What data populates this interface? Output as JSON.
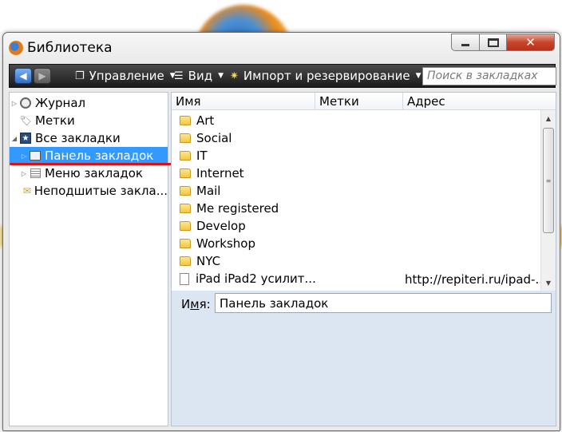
{
  "window": {
    "title": "Библиотека",
    "close_glyph": "✕"
  },
  "toolbar": {
    "back_glyph": "◀",
    "forward_glyph": "▶",
    "manage_label": "Управление",
    "view_label": "Вид",
    "import_label": "Импорт и резервирование",
    "dropdown_glyph": "▼",
    "search_placeholder": "Поиск в закладках"
  },
  "tree": {
    "items": [
      {
        "label": "Журнал",
        "icon": "clock-icon",
        "twisty": "▷"
      },
      {
        "label": "Метки",
        "icon": "tag-icon",
        "twisty": ""
      },
      {
        "label": "Все закладки",
        "icon": "star-icon",
        "twisty": "◢"
      },
      {
        "label": "Панель закладок",
        "icon": "toolbar-icon",
        "twisty": "▷",
        "selected": true
      },
      {
        "label": "Меню закладок",
        "icon": "menu-icon",
        "twisty": "▷"
      },
      {
        "label": "Неподшитые закла...",
        "icon": "unsorted-icon",
        "twisty": ""
      }
    ],
    "highlight_color": "#3399ff",
    "annotation_color": "#e01010"
  },
  "list": {
    "columns": [
      "Имя",
      "Метки",
      "Адрес"
    ],
    "rows": [
      {
        "name": "Art",
        "type": "folder",
        "address": ""
      },
      {
        "name": "Social",
        "type": "folder",
        "address": ""
      },
      {
        "name": "IT",
        "type": "folder",
        "address": ""
      },
      {
        "name": "Internet",
        "type": "folder",
        "address": ""
      },
      {
        "name": "Mail",
        "type": "folder",
        "address": ""
      },
      {
        "name": "Me registered",
        "type": "folder",
        "address": ""
      },
      {
        "name": "Develop",
        "type": "folder",
        "address": ""
      },
      {
        "name": "Workshop",
        "type": "folder",
        "address": ""
      },
      {
        "name": "NYC",
        "type": "folder",
        "address": ""
      },
      {
        "name": "iPad iPad2 усилит...",
        "type": "page",
        "address": "http://repiteri.ru/ipad-..."
      }
    ],
    "scroll_up_glyph": "▲",
    "scroll_down_glyph": "▼",
    "thumb_grip": "≡"
  },
  "details": {
    "name_label_prefix": "И",
    "name_label_accel": "м",
    "name_label_suffix": "я:",
    "name_value": "Панель закладок"
  }
}
